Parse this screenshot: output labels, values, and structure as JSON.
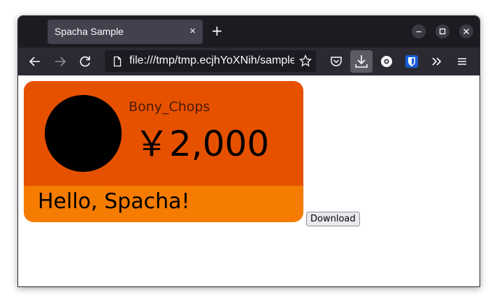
{
  "browser": {
    "tab_title": "Spacha Sample",
    "tab_close_glyph": "×",
    "new_tab_glyph": "+",
    "url": "file:///tmp/tmp.ecjhYoXNih/sample.html",
    "icons": {
      "back": "back-arrow-icon",
      "forward": "forward-arrow-icon",
      "reload": "reload-icon",
      "page": "page-icon",
      "bookmark": "star-icon",
      "pocket": "pocket-icon",
      "downloads": "download-icon",
      "extension": "extension-icon",
      "bitwarden": "bitwarden-shield-icon",
      "overflow": "overflow-chevrons-icon",
      "menu": "hamburger-menu-icon"
    }
  },
  "card": {
    "username": "Bony_Chops",
    "amount": "￥2,000",
    "message": "Hello, Spacha!",
    "colors": {
      "top": "#e65100",
      "bottom": "#f57c00",
      "avatar": "#000000"
    }
  },
  "page": {
    "download_label": "Download"
  }
}
